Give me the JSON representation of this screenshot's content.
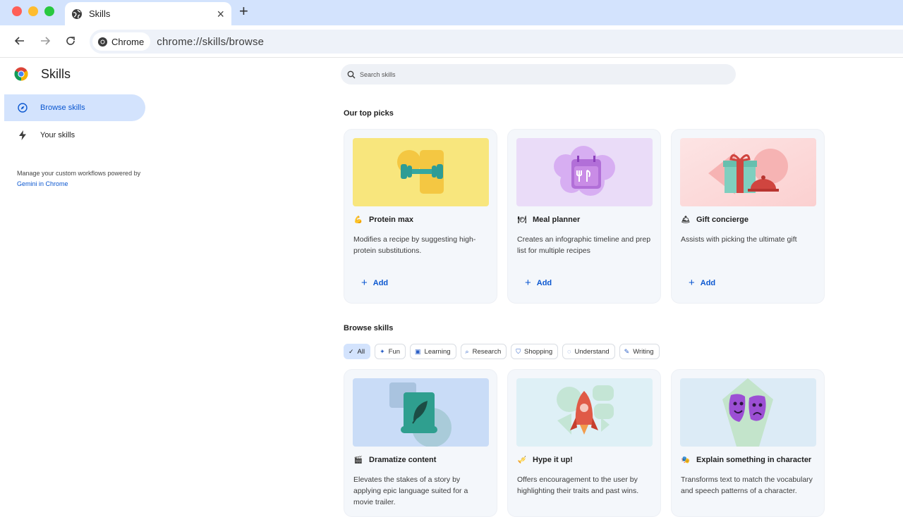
{
  "browser": {
    "tab_title": "Skills",
    "omnibox_chip": "Chrome",
    "url": "chrome://skills/browse"
  },
  "sidebar": {
    "app_title": "Skills",
    "items": [
      {
        "label": "Browse skills",
        "icon": "compass-icon",
        "active": true
      },
      {
        "label": "Your skills",
        "icon": "bolt-icon",
        "active": false
      }
    ],
    "note_text": "Manage your custom workflows powered by",
    "note_link": "Gemini in Chrome"
  },
  "search": {
    "placeholder": "Search skills"
  },
  "top_picks": {
    "heading": "Our top picks",
    "cards": [
      {
        "emoji": "💪",
        "title": "Protein max",
        "description": "Modifies a recipe by suggesting high-protein substitutions.",
        "add_label": "Add"
      },
      {
        "emoji": "🍽",
        "title": "Meal planner",
        "description": "Creates an infographic timeline and prep list for multiple recipes",
        "add_label": "Add"
      },
      {
        "emoji": "🛎",
        "title": "Gift concierge",
        "description": "Assists with picking the ultimate gift",
        "add_label": "Add"
      }
    ]
  },
  "browse": {
    "heading": "Browse skills",
    "filters": [
      {
        "label": "All",
        "icon": "✓",
        "selected": true
      },
      {
        "label": "Fun",
        "icon": "✦",
        "selected": false
      },
      {
        "label": "Learning",
        "icon": "▣",
        "selected": false
      },
      {
        "label": "Research",
        "icon": "⌕",
        "selected": false
      },
      {
        "label": "Shopping",
        "icon": "⛉",
        "selected": false
      },
      {
        "label": "Understand",
        "icon": "◌",
        "selected": false
      },
      {
        "label": "Writing",
        "icon": "✎",
        "selected": false
      }
    ],
    "cards": [
      {
        "emoji": "🎬",
        "title": "Dramatize content",
        "description": "Elevates the stakes of a story by applying epic language suited for a movie trailer."
      },
      {
        "emoji": "🎺",
        "title": "Hype it up!",
        "description": "Offers encouragement to the user by highlighting their traits and past wins."
      },
      {
        "emoji": "🎭",
        "title": "Explain something in character",
        "description": "Transforms text to match the vocabulary and speech patterns of a character."
      }
    ]
  },
  "colors": {
    "accent": "#0b57d0",
    "active_bg": "#d3e3fd",
    "card_bg": "#f4f7fb"
  }
}
